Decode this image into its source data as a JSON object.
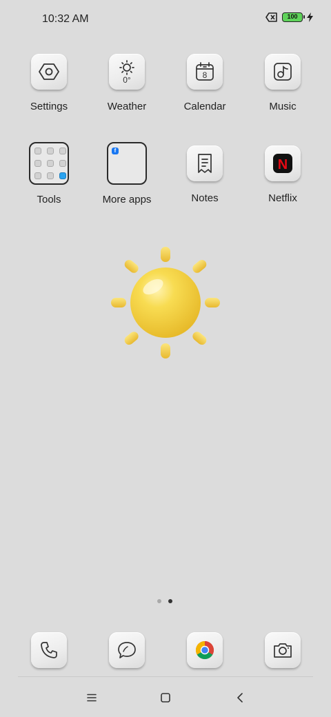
{
  "status_bar": {
    "time": "10:32 AM",
    "battery": "100",
    "icons": [
      "no-sim-icon",
      "battery-icon",
      "charging-bolt-icon"
    ]
  },
  "apps": [
    {
      "label": "Settings",
      "icon": "settings-icon"
    },
    {
      "label": "Weather",
      "icon": "weather-icon",
      "glyph": "0°"
    },
    {
      "label": "Calendar",
      "icon": "calendar-icon",
      "glyph": "8"
    },
    {
      "label": "Music",
      "icon": "music-icon"
    },
    {
      "label": "Tools",
      "icon": "folder-icon"
    },
    {
      "label": "More apps",
      "icon": "folder-icon",
      "glyph": "f"
    },
    {
      "label": "Notes",
      "icon": "notes-icon"
    },
    {
      "label": "Netflix",
      "icon": "netflix-icon",
      "glyph": "N"
    }
  ],
  "widget": {
    "icon": "sun-icon"
  },
  "page_indicator": {
    "count": 2,
    "active": 2
  },
  "dock": [
    {
      "icon": "phone-icon"
    },
    {
      "icon": "messages-icon"
    },
    {
      "icon": "chrome-icon"
    },
    {
      "icon": "camera-icon"
    }
  ],
  "nav": [
    {
      "icon": "menu-icon"
    },
    {
      "icon": "home-icon"
    },
    {
      "icon": "back-icon"
    }
  ],
  "colors": {
    "background": "#dcdcdc",
    "battery_fill": "#5fd35a",
    "sun": "#f5d13b",
    "netflix_red": "#e50914"
  }
}
